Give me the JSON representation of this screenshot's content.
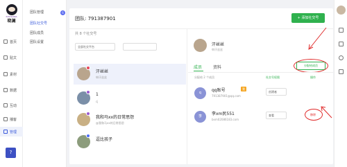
{
  "logo": {
    "brand_en": "XIAOLIANA",
    "brand_cn": "晓澜"
  },
  "rail": {
    "items": [
      {
        "label": "首页",
        "icon": "home-icon"
      },
      {
        "label": "贴文",
        "icon": "post-icon"
      },
      {
        "label": "素材",
        "icon": "media-icon"
      },
      {
        "label": "数据",
        "icon": "chart-icon"
      },
      {
        "label": "互动",
        "icon": "chat-icon"
      },
      {
        "label": "播客",
        "icon": "podcast-icon"
      },
      {
        "label": "管理",
        "icon": "settings-icon"
      }
    ],
    "help": "?"
  },
  "subnav": {
    "items": [
      "团队管理",
      "团队社交号",
      "团队成员",
      "团队设置"
    ],
    "badge": "6"
  },
  "header": {
    "team_title": "团队: 791387901",
    "add_button": "+ 添加社交号"
  },
  "list": {
    "count_text": "共 8 个社交号",
    "platform_select": "全部社交平台",
    "search_placeholder": "",
    "accounts": [
      {
        "name": "汗丝丝",
        "sub": "申汗丝丝"
      },
      {
        "name": "1",
        "sub": "cj"
      },
      {
        "name": "我和马xx的日常思怨",
        "sub": "@我和马xx的日常思怨"
      },
      {
        "name": "逗比孩子",
        "sub": ""
      }
    ]
  },
  "detail": {
    "name": "汗丝丝",
    "sub": "申汗丝丝",
    "tabs": [
      "成员",
      "资料"
    ],
    "assign_button": "分配给成员",
    "table_headers": [
      "分配给 2 个成员",
      "社交号权限",
      "操作"
    ],
    "members": [
      {
        "avatar": "q",
        "name": "qq账号",
        "role": "我",
        "email": "791387901@qq.com",
        "permission": "创建者",
        "action": ""
      },
      {
        "avatar": "李",
        "name": "李xm民551",
        "role": "",
        "email": "bxm02086183.com",
        "permission": "查看",
        "action": "移除"
      }
    ]
  },
  "colors": {
    "accent": "#2fb14e",
    "brand": "#3b5bdb",
    "annotation": "#e02b2b"
  },
  "right_strip": {
    "icons": [
      "user-avatar-icon",
      "bell-icon",
      "send-icon",
      "plus-circle-icon",
      "logout-icon"
    ]
  }
}
